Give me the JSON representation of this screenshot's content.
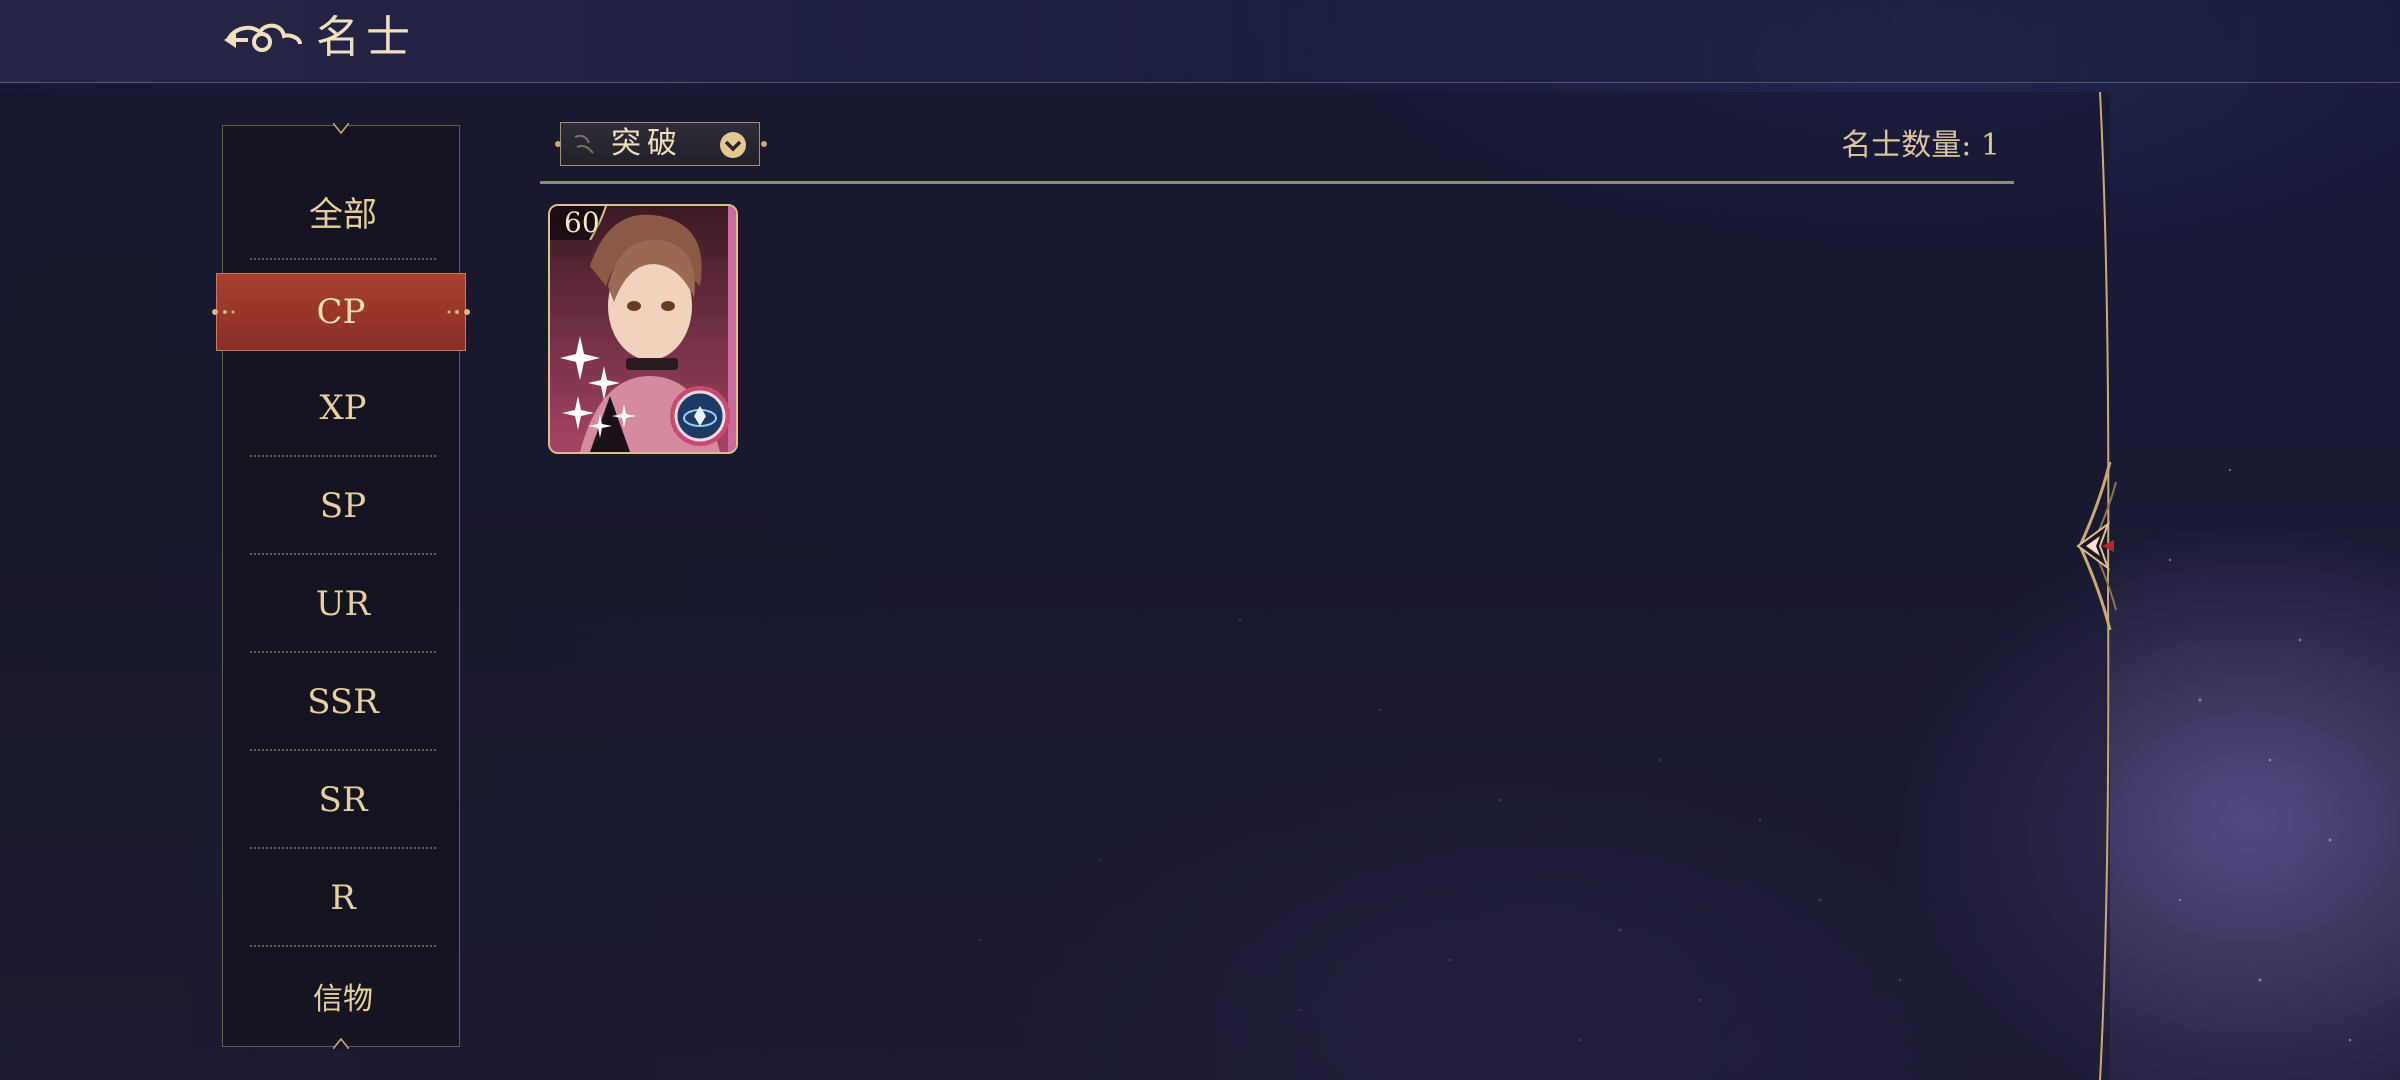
{
  "header": {
    "title": "名士"
  },
  "sidebar": {
    "categories": [
      {
        "label": "全部"
      },
      {
        "label": "CP"
      },
      {
        "label": "XP"
      },
      {
        "label": "SP"
      },
      {
        "label": "UR"
      },
      {
        "label": "SSR"
      },
      {
        "label": "SR"
      },
      {
        "label": "R"
      },
      {
        "label": "信物"
      }
    ],
    "active": "CP"
  },
  "toolbar": {
    "filter_label": "突破",
    "count_label": "名士数量: 1"
  },
  "cards": [
    {
      "level": "60"
    }
  ],
  "colors": {
    "accent_gold": "#e6cf9c",
    "active_red": "#9a372a",
    "panel_bg": "#141422"
  },
  "icons": {
    "back": "cloud-back-icon",
    "filter": "chevron-down-circle-icon",
    "expand": "arrow-left-icon"
  }
}
